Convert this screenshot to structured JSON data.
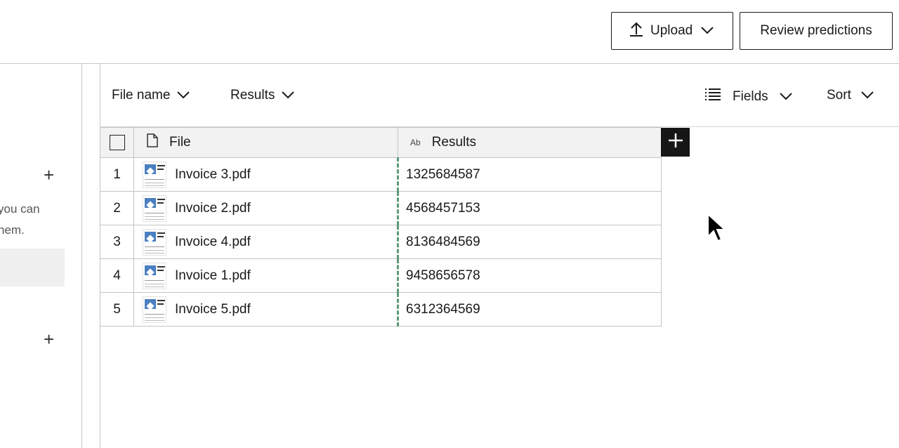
{
  "topbar": {
    "upload_label": "Upload",
    "review_label": "Review predictions"
  },
  "left_panel": {
    "text_line1": "you can",
    "text_line2": "hem."
  },
  "toolbar": {
    "file_name_filter": "File name",
    "results_filter": "Results",
    "fields_label": "Fields",
    "sort_label": "Sort"
  },
  "table": {
    "headers": {
      "file": "File",
      "results_type": "Ab",
      "results": "Results"
    },
    "rows": [
      {
        "num": "1",
        "file": "Invoice 3.pdf",
        "result": "1325684587"
      },
      {
        "num": "2",
        "file": "Invoice 2.pdf",
        "result": "4568457153"
      },
      {
        "num": "3",
        "file": "Invoice 4.pdf",
        "result": "8136484569"
      },
      {
        "num": "4",
        "file": "Invoice 1.pdf",
        "result": "9458656578"
      },
      {
        "num": "5",
        "file": "Invoice 5.pdf",
        "result": "6312364569"
      }
    ]
  },
  "icons": [
    "upload-icon",
    "chevron-down-icon",
    "plus-icon",
    "list-icon",
    "document-icon",
    "pdf-thumbnail-icon",
    "mouse-cursor-icon"
  ],
  "colors": {
    "accent_dark": "#161616",
    "result_column_marker": "#5e9a78",
    "header_bg": "#f2f2f2"
  }
}
